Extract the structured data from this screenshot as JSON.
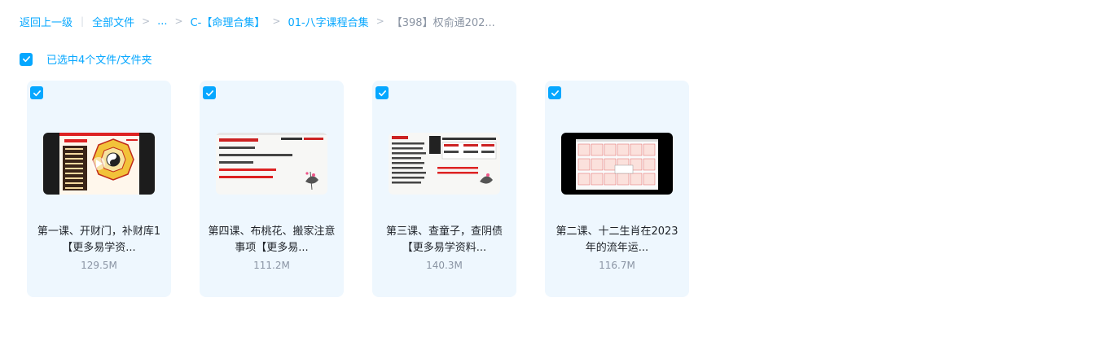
{
  "breadcrumb": {
    "back": "返回上一级",
    "items": [
      "全部文件",
      "...",
      "C-【命理合集】",
      "01-八字课程合集"
    ],
    "current": "【398】权俞通202...",
    "separator": ">",
    "divider": "|"
  },
  "selection": {
    "label": "已选中4个文件/文件夹",
    "checked": true
  },
  "colors": {
    "accent": "#06a7ff",
    "card_bg": "#eef7fe",
    "muted": "#8a94a3"
  },
  "files": [
    {
      "title": "第一课、开财门，补财库1【更多易学资...",
      "size": "129.5M",
      "checked": true,
      "icon": "video-thumbnail",
      "play_icon": "play-icon"
    },
    {
      "title": "第四课、布桃花、搬家注意事项【更多易...",
      "size": "111.2M",
      "checked": true,
      "icon": "video-thumbnail"
    },
    {
      "title": "第三课、查童子，查阴债【更多易学资料...",
      "size": "140.3M",
      "checked": true,
      "icon": "video-thumbnail"
    },
    {
      "title": "第二课、十二生肖在2023年的流年运...",
      "size": "116.7M",
      "checked": true,
      "icon": "video-thumbnail"
    }
  ]
}
